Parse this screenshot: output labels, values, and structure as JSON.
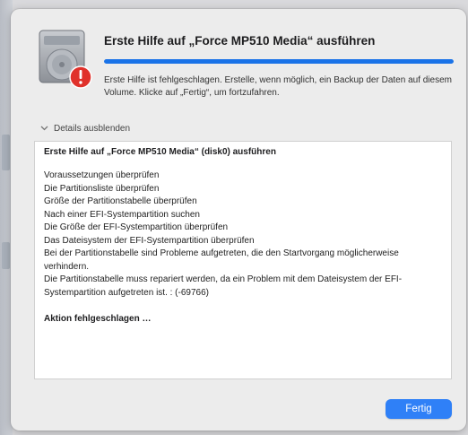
{
  "dialog": {
    "title": "Erste Hilfe auf „Force MP510 Media“ ausführen",
    "progress": 1.0,
    "message": "Erste Hilfe ist fehlgeschlagen. Erstelle, wenn möglich, ein Backup der Daten auf diesem Volume. Klicke auf „Fertig“, um fortzufahren.",
    "details_toggle_label": "Details ausblenden",
    "log": {
      "header": "Erste Hilfe auf „Force MP510 Media“ (disk0) ausführen",
      "lines": [
        "Voraussetzungen überprüfen",
        "Die Partitionsliste überprüfen",
        "Größe der Partitionstabelle überprüfen",
        "Nach einer EFI-Systempartition suchen",
        "Die Größe der EFI-Systempartition überprüfen",
        "Das Dateisystem der EFI-Systempartition überprüfen",
        "Bei der Partitionstabelle sind Probleme aufgetreten, die den Startvorgang möglicherweise verhindern.",
        "Die Partitionstabelle muss repariert werden, da ein Problem mit dem Dateisystem der EFI-Systempartition aufgetreten ist. : (-69766)"
      ],
      "footer": "Aktion fehlgeschlagen …"
    },
    "done_button_label": "Fertig",
    "icons": {
      "disk": "hard-disk-icon",
      "alert": "alert-badge-icon",
      "chevron": "chevron-down-icon"
    },
    "colors": {
      "accent": "#2f80f7",
      "progress": "#1a73e8",
      "alert": "#e0312b"
    }
  }
}
